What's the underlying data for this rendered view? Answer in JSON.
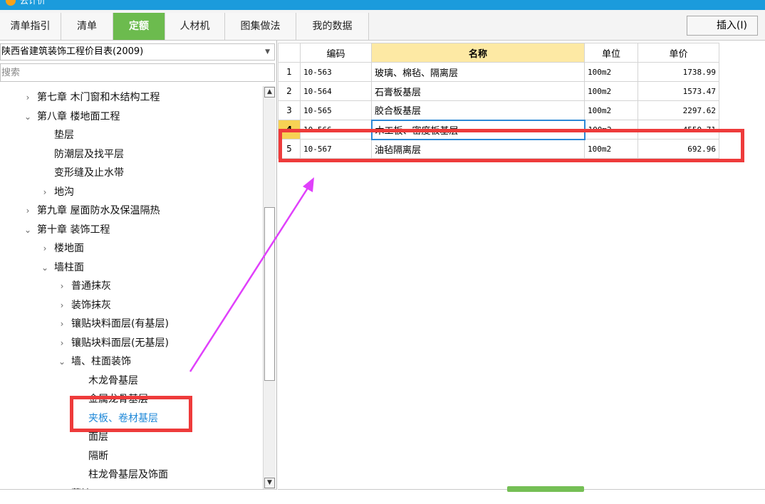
{
  "window": {
    "title": "云计价",
    "accent": "#1b9bdc"
  },
  "tabs": [
    {
      "label": "清单指引"
    },
    {
      "label": "清单"
    },
    {
      "label": "定额"
    },
    {
      "label": "人材机"
    },
    {
      "label": "图集做法"
    },
    {
      "label": "我的数据"
    }
  ],
  "active_tab": "定额",
  "toolbar": {
    "insert_label": "插入(I)"
  },
  "library": {
    "selected": "陕西省建筑装饰工程价目表(2009)"
  },
  "search": {
    "placeholder": "搜索",
    "value": ""
  },
  "tree": [
    {
      "label": "第七章 木门窗和木结构工程",
      "state": "collapsed"
    },
    {
      "label": "第八章 楼地面工程",
      "state": "expanded"
    },
    {
      "label": "垫层",
      "state": "leaf"
    },
    {
      "label": "防潮层及找平层",
      "state": "leaf"
    },
    {
      "label": "变形缝及止水带",
      "state": "leaf"
    },
    {
      "label": "地沟",
      "state": "collapsed"
    },
    {
      "label": "第九章 屋面防水及保温隔热",
      "state": "collapsed"
    },
    {
      "label": "第十章 装饰工程",
      "state": "expanded"
    },
    {
      "label": "楼地面",
      "state": "collapsed"
    },
    {
      "label": "墙柱面",
      "state": "expanded"
    },
    {
      "label": "普通抹灰",
      "state": "collapsed"
    },
    {
      "label": "装饰抹灰",
      "state": "collapsed"
    },
    {
      "label": "镶贴块料面层(有基层)",
      "state": "collapsed"
    },
    {
      "label": "镶贴块料面层(无基层)",
      "state": "collapsed"
    },
    {
      "label": "墙、柱面装饰",
      "state": "expanded"
    },
    {
      "label": "木龙骨基层",
      "state": "leaf"
    },
    {
      "label": "金属龙骨基层",
      "state": "leaf"
    },
    {
      "label": "夹板、卷材基层",
      "state": "leaf",
      "selected": true
    },
    {
      "label": "面层",
      "state": "leaf"
    },
    {
      "label": "隔断",
      "state": "leaf"
    },
    {
      "label": "柱龙骨基层及饰面",
      "state": "leaf"
    },
    {
      "label": "幕墙",
      "state": "leaf"
    }
  ],
  "table": {
    "columns": [
      "编码",
      "名称",
      "单位",
      "单价"
    ],
    "rows": [
      {
        "idx": "1",
        "code": "10-563",
        "name": "玻璃、棉毡、隔离层",
        "unit": "100m2",
        "price": "1738.99"
      },
      {
        "idx": "2",
        "code": "10-564",
        "name": "石膏板基层",
        "unit": "100m2",
        "price": "1573.47"
      },
      {
        "idx": "3",
        "code": "10-565",
        "name": "胶合板基层",
        "unit": "100m2",
        "price": "2297.62"
      },
      {
        "idx": "4",
        "code": "10-566",
        "name": "木工板、密度板基层",
        "unit": "100m2",
        "price": "4550.71"
      },
      {
        "idx": "5",
        "code": "10-567",
        "name": "油毡隔离层",
        "unit": "100m2",
        "price": "692.96"
      }
    ],
    "selected_row": 3
  },
  "colors": {
    "tab_active": "#6cbb4e",
    "highlight": "#ee3b3b",
    "arrow": "#e040fb",
    "header_name": "#fde9a4",
    "selection": "#1e88d8"
  }
}
